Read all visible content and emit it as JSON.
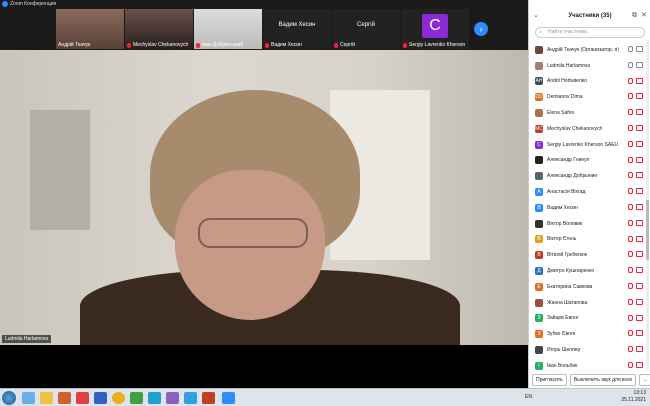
{
  "window": {
    "title": "Zoom Конференция"
  },
  "strip": {
    "thumbs": [
      {
        "name": "Андрій Ткачук",
        "mic_muted": false
      },
      {
        "name": "Mechyslav Chekanovych",
        "mic_muted": true
      },
      {
        "name": "Іван Добрянський",
        "mic_muted": true
      },
      {
        "name": "Вадим Хесин",
        "mic_muted": true,
        "center": "Вадим Хесин"
      },
      {
        "name": "Сергій",
        "mic_muted": true,
        "center": "Сергій"
      },
      {
        "name": "Sergiy Lavrenko Kherson",
        "mic_muted": true,
        "avatar": "C"
      }
    ],
    "next_icon": "chevron-right-icon"
  },
  "main": {
    "name": "Ludmila Harlamova"
  },
  "panel": {
    "title": "Участники (35)",
    "search_placeholder": "Найти участника",
    "participants": [
      {
        "name": "Андрій Ткачук (Организатор, я)",
        "initials": "",
        "color": "#6b4a3a",
        "mic": "on",
        "video": "on"
      },
      {
        "name": "Ludmila Harlamova",
        "initials": "",
        "color": "#a08070",
        "mic": "on",
        "video": "on"
      },
      {
        "name": "Andrii Horbatenko",
        "initials": "AH",
        "color": "#3b4a5a",
        "mic": "off",
        "video": "off"
      },
      {
        "name": "Demianov Dima",
        "initials": "DD",
        "color": "#e07020",
        "mic": "off",
        "video": "off"
      },
      {
        "name": "Elena Safno",
        "initials": "",
        "color": "#b07050",
        "mic": "off",
        "video": "off"
      },
      {
        "name": "Mechyslav Chekanovych",
        "initials": "MC",
        "color": "#c0392b",
        "mic": "off",
        "video": "off"
      },
      {
        "name": "Sergiy Lavrenko Kherson SAEU",
        "initials": "C",
        "color": "#8a2bd6",
        "mic": "off",
        "video": "off"
      },
      {
        "name": "Александр Гниеул",
        "initials": "",
        "color": "#222222",
        "mic": "off",
        "video": "off"
      },
      {
        "name": "Александр Добрынин",
        "initials": "",
        "color": "#556070",
        "mic": "off",
        "video": "off"
      },
      {
        "name": "Анастасія Віхгад",
        "initials": "А",
        "color": "#2d8cff",
        "mic": "off",
        "video": "off"
      },
      {
        "name": "Вадим Хесин",
        "initials": "В",
        "color": "#2d8cff",
        "mic": "off",
        "video": "off"
      },
      {
        "name": "Віктор Воловик",
        "initials": "",
        "color": "#333333",
        "mic": "off",
        "video": "off"
      },
      {
        "name": "Віктор Єгонь",
        "initials": "В",
        "color": "#e0a020",
        "mic": "off",
        "video": "off"
      },
      {
        "name": "Віталій Гребенюк",
        "initials": "В",
        "color": "#c0392b",
        "mic": "off",
        "video": "off"
      },
      {
        "name": "Дмитро Кушнаренко",
        "initials": "Д",
        "color": "#2d6cbf",
        "mic": "off",
        "video": "off"
      },
      {
        "name": "Екатерина Савкова",
        "initials": "Е",
        "color": "#e07020",
        "mic": "off",
        "video": "off"
      },
      {
        "name": "Жанна Шатапова",
        "initials": "",
        "color": "#9a5040",
        "mic": "off",
        "video": "off"
      },
      {
        "name": "Зайцев Евген",
        "initials": "З",
        "color": "#27ae60",
        "mic": "off",
        "video": "off"
      },
      {
        "name": "Зубко Євген",
        "initials": "З",
        "color": "#e07020",
        "mic": "off",
        "video": "off"
      },
      {
        "name": "Игорь Шелпер",
        "initials": "",
        "color": "#444444",
        "mic": "off",
        "video": "off"
      },
      {
        "name": "Іван Вольбик",
        "initials": "І",
        "color": "#27ae60",
        "mic": "off",
        "video": "off"
      }
    ],
    "invite_label": "Пригласить",
    "mute_all_label": "Выключить звук для всех",
    "more_label": "..."
  },
  "taskbar": {
    "lang": "EN",
    "time": "13:13",
    "date": "25.11.2021"
  }
}
